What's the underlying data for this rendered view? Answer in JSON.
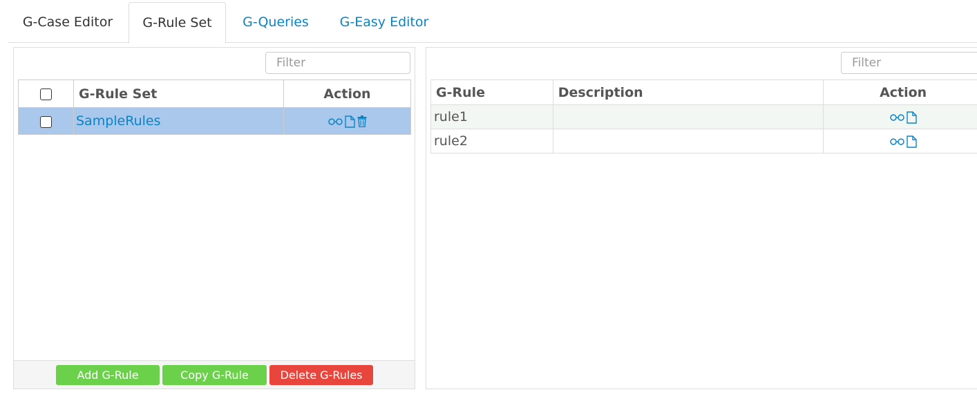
{
  "tabs": [
    {
      "label": "G-Case Editor"
    },
    {
      "label": "G-Rule Set"
    },
    {
      "label": "G-Queries"
    },
    {
      "label": "G-Easy Editor"
    }
  ],
  "left_panel": {
    "filter_placeholder": "Filter",
    "columns": [
      "G-Rule Set",
      "Action"
    ],
    "rows": [
      {
        "name": "SampleRules",
        "selected": true,
        "actions": [
          "view-icon",
          "document-icon",
          "trash-icon"
        ]
      }
    ],
    "buttons": {
      "add": "Add G-Rule",
      "copy": "Copy G-Rule",
      "delete": "Delete G-Rules"
    }
  },
  "right_panel": {
    "filter_placeholder": "Filter",
    "columns": [
      "G-Rule",
      "Description",
      "Action"
    ],
    "rows": [
      {
        "rule": "rule1",
        "description": "",
        "actions": [
          "view-icon",
          "document-icon"
        ]
      },
      {
        "rule": "rule2",
        "description": "",
        "actions": [
          "view-icon",
          "document-icon"
        ]
      }
    ]
  },
  "colors": {
    "link": "#0b84c6",
    "selected_row": "#a9c8ec",
    "button_green": "#6cd14a",
    "button_red": "#e8463c"
  }
}
